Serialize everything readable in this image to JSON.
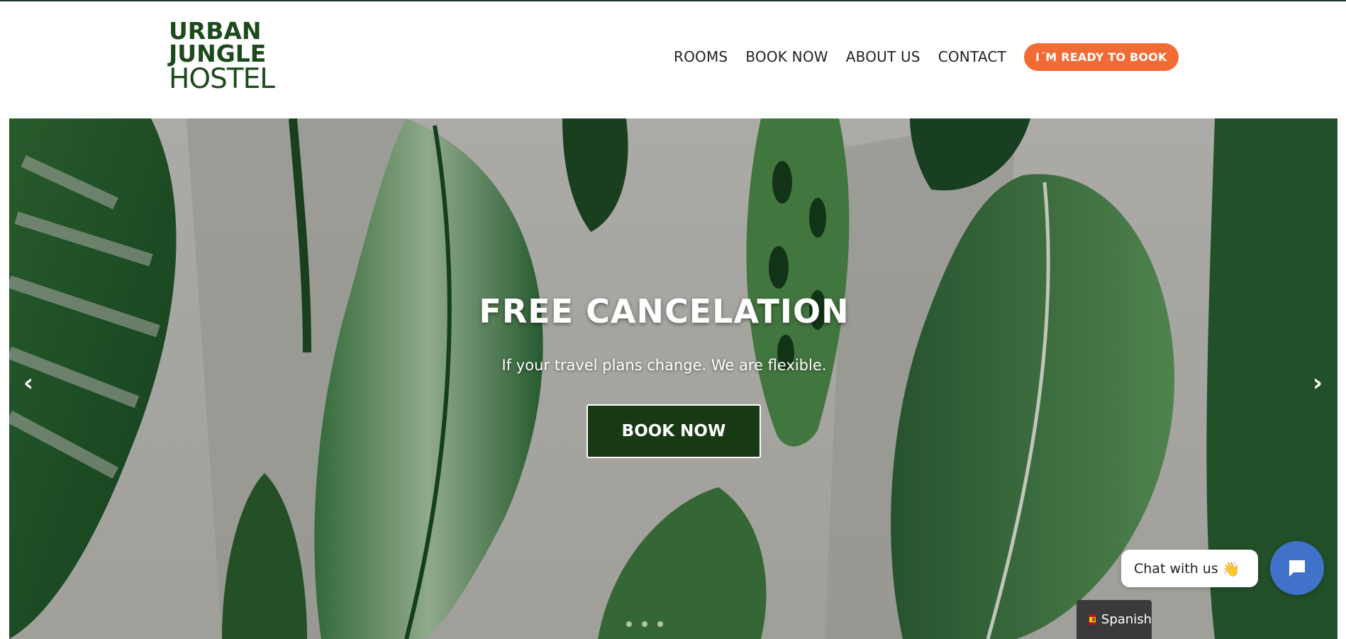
{
  "logo": {
    "line1": "URBAN",
    "line2": "JUNGLE",
    "line3": "HOSTEL"
  },
  "nav": {
    "items": [
      "ROOMS",
      "BOOK NOW",
      "ABOUT US",
      "CONTACT"
    ],
    "cta_label": "I´M READY TO BOOK"
  },
  "hero": {
    "title": "FREE CANCELATION",
    "subtitle": "If your travel plans change. We are flexible.",
    "button_label": "BOOK NOW",
    "prev_icon": "chevron-left-icon",
    "next_icon": "chevron-right-icon",
    "slide_count": 3
  },
  "chat": {
    "label": "Chat with us",
    "emoji": "👋",
    "icon": "chat-icon"
  },
  "language": {
    "label": "Spanish",
    "flag": "spain-flag-icon"
  },
  "colors": {
    "brand_green": "#1d4a1c",
    "cta_orange": "#f26a34",
    "hero_button": "#173a12",
    "chat_blue": "#3f72c8"
  }
}
